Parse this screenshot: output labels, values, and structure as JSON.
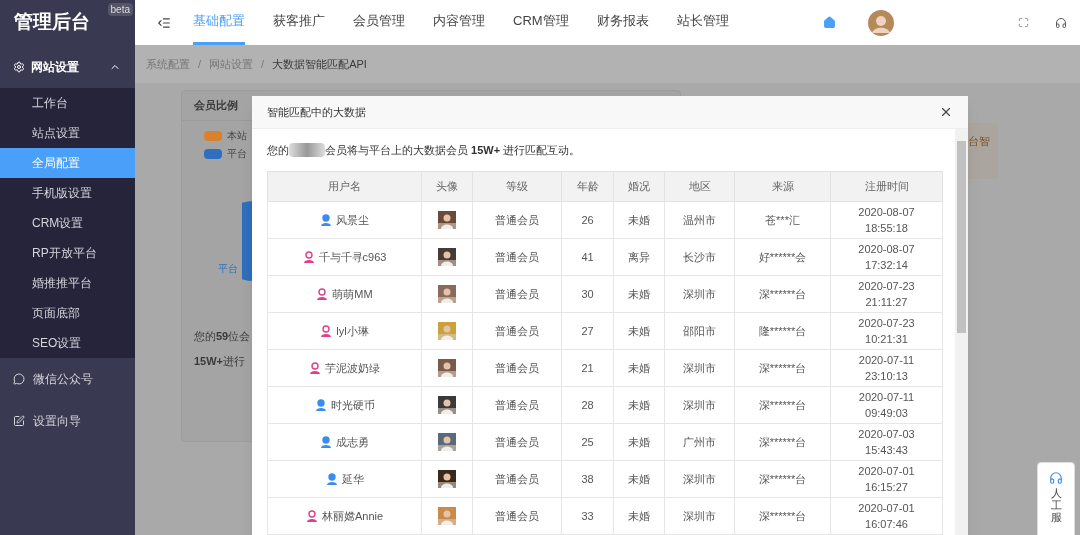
{
  "sidebar": {
    "title": "管理后台",
    "badge": "beta",
    "group": {
      "label": "网站设置",
      "expanded": true,
      "items": [
        {
          "label": "工作台",
          "selected": false
        },
        {
          "label": "站点设置",
          "selected": false
        },
        {
          "label": "全局配置",
          "selected": true
        },
        {
          "label": "手机版设置",
          "selected": false
        },
        {
          "label": "CRM设置",
          "selected": false
        },
        {
          "label": "RP开放平台",
          "selected": false
        },
        {
          "label": "婚推推平台",
          "selected": false
        },
        {
          "label": "页面底部",
          "selected": false
        },
        {
          "label": "SEO设置",
          "selected": false
        }
      ]
    },
    "entries": [
      {
        "kind": "wechat",
        "label": "微信公众号"
      },
      {
        "kind": "guide",
        "label": "设置向导"
      }
    ]
  },
  "nav": {
    "tabs": [
      {
        "label": "基础配置",
        "selected": true
      },
      {
        "label": "获客推广",
        "selected": false
      },
      {
        "label": "会员管理",
        "selected": false
      },
      {
        "label": "内容管理",
        "selected": false
      },
      {
        "label": "CRM管理",
        "selected": false
      },
      {
        "label": "财务报表",
        "selected": false
      },
      {
        "label": "站长管理",
        "selected": false
      }
    ]
  },
  "breadcrumb": {
    "separator": "/",
    "items": [
      "系统配置",
      "网站设置",
      "大数据智能匹配API"
    ]
  },
  "card": {
    "title": "会员比例",
    "legend": [
      {
        "label": "本站",
        "color": "#d9822b"
      },
      {
        "label": "平台",
        "color": "#2f6fbd"
      }
    ],
    "link": "平台",
    "note_1": "您的**59**位会",
    "note_2": "**15W+**进行"
  },
  "side_note": "台智",
  "modal": {
    "title": "智能匹配中的大数据",
    "intro_start": "您的",
    "intro_rest": "会员将与平台上的大数据会员 **15W+** 进行匹配互动。",
    "columns": [
      "用户名",
      "头像",
      "等级",
      "年龄",
      "婚况",
      "地区",
      "来源",
      "注册时间"
    ],
    "rows": [
      {
        "name": "风景尘",
        "kind": "male",
        "level": "普通会员",
        "age": "26",
        "marital": "未婚",
        "region": "温州市",
        "source": "苍***汇",
        "date": "2020-08-07",
        "time": "18:55:18"
      },
      {
        "name": "千与千寻c963",
        "kind": "female",
        "level": "普通会员",
        "age": "41",
        "marital": "离异",
        "region": "长沙市",
        "source": "好******会",
        "date": "2020-08-07",
        "time": "17:32:14"
      },
      {
        "name": "萌萌MM",
        "kind": "female",
        "level": "普通会员",
        "age": "30",
        "marital": "未婚",
        "region": "深圳市",
        "source": "深******台",
        "date": "2020-07-23",
        "time": "21:11:27"
      },
      {
        "name": "lyl小琳",
        "kind": "female",
        "level": "普通会员",
        "age": "27",
        "marital": "未婚",
        "region": "邵阳市",
        "source": "隆******台",
        "date": "2020-07-23",
        "time": "10:21:31"
      },
      {
        "name": "芋泥波奶绿",
        "kind": "female",
        "level": "普通会员",
        "age": "21",
        "marital": "未婚",
        "region": "深圳市",
        "source": "深******台",
        "date": "2020-07-11",
        "time": "23:10:13"
      },
      {
        "name": "时光硬币",
        "kind": "male",
        "level": "普通会员",
        "age": "28",
        "marital": "未婚",
        "region": "深圳市",
        "source": "深******台",
        "date": "2020-07-11",
        "time": "09:49:03"
      },
      {
        "name": "成志勇",
        "kind": "male",
        "level": "普通会员",
        "age": "25",
        "marital": "未婚",
        "region": "广州市",
        "source": "深******台",
        "date": "2020-07-03",
        "time": "15:43:43"
      },
      {
        "name": "延华",
        "kind": "male",
        "level": "普通会员",
        "age": "38",
        "marital": "未婚",
        "region": "深圳市",
        "source": "深******台",
        "date": "2020-07-01",
        "time": "16:15:27"
      },
      {
        "name": "林丽嫦Annie",
        "kind": "female",
        "level": "普通会员",
        "age": "33",
        "marital": "未婚",
        "region": "深圳市",
        "source": "深******台",
        "date": "2020-07-01",
        "time": "16:07:46"
      }
    ]
  },
  "support": {
    "label": "人工服"
  }
}
